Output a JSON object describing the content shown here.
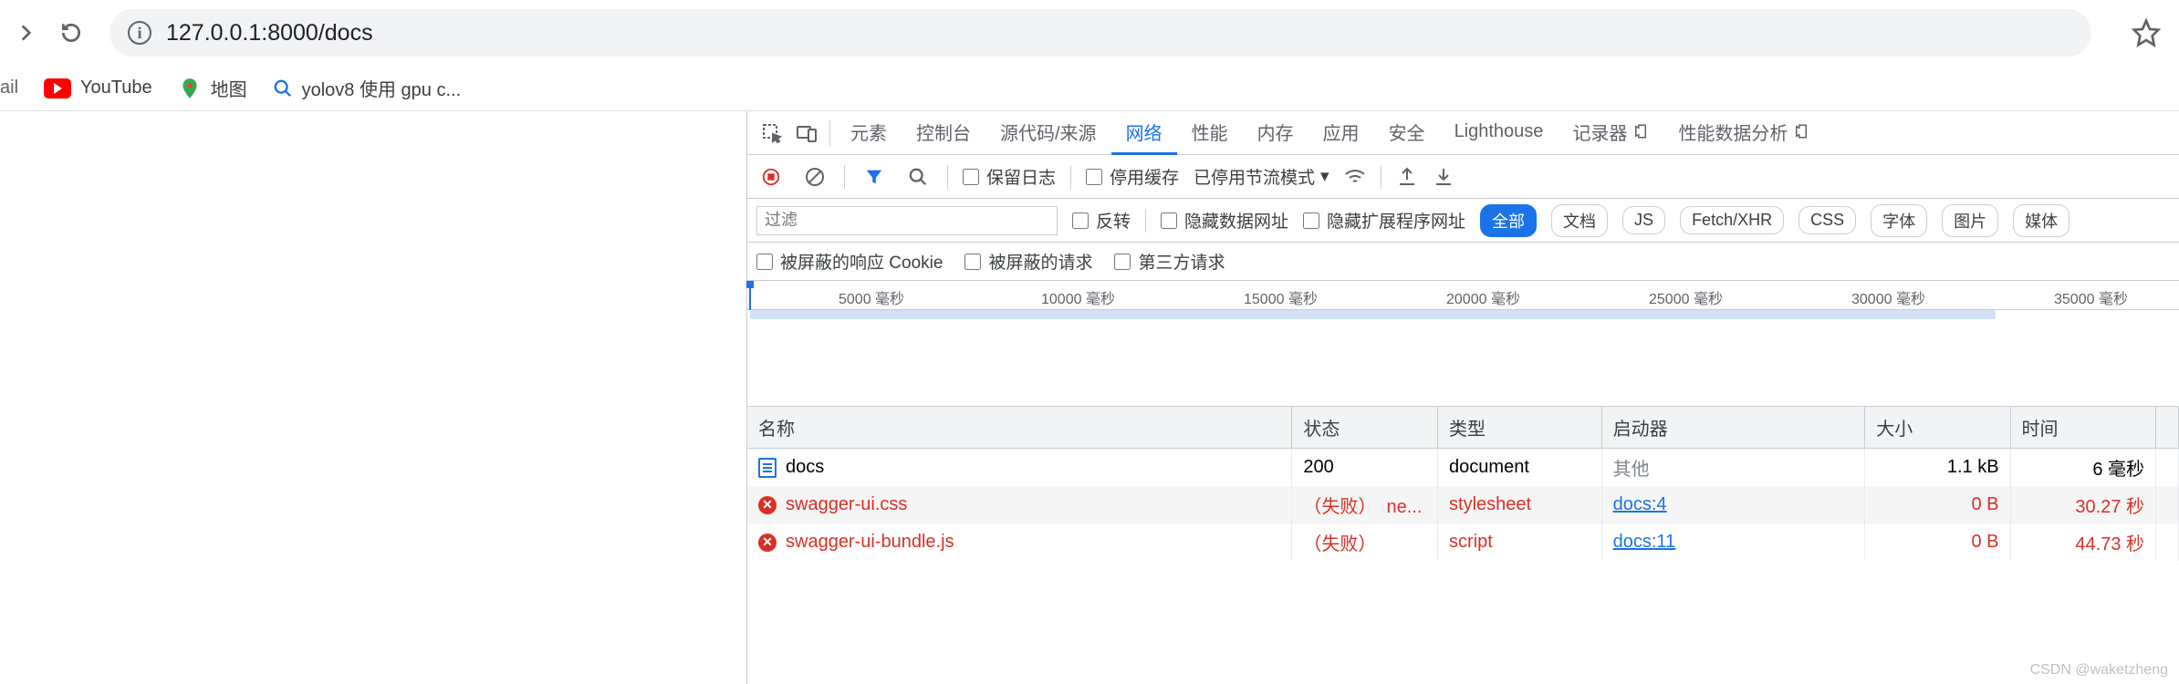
{
  "browser": {
    "url": "127.0.0.1:8000/docs",
    "bookmarks": [
      {
        "label": "ail",
        "icon": "none"
      },
      {
        "label": "YouTube",
        "icon": "youtube"
      },
      {
        "label": "地图",
        "icon": "maps"
      },
      {
        "label": "yolov8 使用 gpu c...",
        "icon": "search"
      }
    ]
  },
  "devtools": {
    "tabs": {
      "elements": "元素",
      "console": "控制台",
      "sources": "源代码/来源",
      "network": "网络",
      "performance": "性能",
      "memory": "内存",
      "application": "应用",
      "security": "安全",
      "lighthouse": "Lighthouse",
      "recorder": "记录器",
      "perf_insights": "性能数据分析"
    },
    "active_tab": "network",
    "toolbar": {
      "preserve_log": "保留日志",
      "disable_cache": "停用缓存",
      "throttling": "已停用节流模式"
    },
    "filter": {
      "placeholder": "过滤",
      "invert": "反转",
      "hide_data_urls": "隐藏数据网址",
      "hide_ext_urls": "隐藏扩展程序网址",
      "types": {
        "all": "全部",
        "doc": "文档",
        "js": "JS",
        "fetch": "Fetch/XHR",
        "css": "CSS",
        "font": "字体",
        "img": "图片",
        "media": "媒体"
      },
      "blocked_cookies": "被屏蔽的响应 Cookie",
      "blocked_requests": "被屏蔽的请求",
      "third_party": "第三方请求"
    },
    "timeline": {
      "ticks": [
        "5000 毫秒",
        "10000 毫秒",
        "15000 毫秒",
        "20000 毫秒",
        "25000 毫秒",
        "30000 毫秒",
        "35000 毫秒"
      ]
    },
    "columns": {
      "name": "名称",
      "status": "状态",
      "type": "类型",
      "initiator": "启动器",
      "size": "大小",
      "time": "时间",
      "waterfall": ""
    },
    "requests": [
      {
        "name": "docs",
        "icon": "doc",
        "status": "200",
        "status_extra": "",
        "type": "document",
        "initiator": "其他",
        "initiator_link": false,
        "size": "1.1 kB",
        "time": "6 毫秒",
        "failed": false
      },
      {
        "name": "swagger-ui.css",
        "icon": "err",
        "status": "（失败）",
        "status_extra": "ne...",
        "type": "stylesheet",
        "initiator": "docs:4",
        "initiator_link": true,
        "size": "0 B",
        "time": "30.27 秒",
        "failed": true
      },
      {
        "name": "swagger-ui-bundle.js",
        "icon": "err",
        "status": "（失败）",
        "status_extra": "",
        "type": "script",
        "initiator": "docs:11",
        "initiator_link": true,
        "size": "0 B",
        "time": "44.73 秒",
        "failed": true
      }
    ]
  },
  "watermark": "CSDN @waketzheng"
}
